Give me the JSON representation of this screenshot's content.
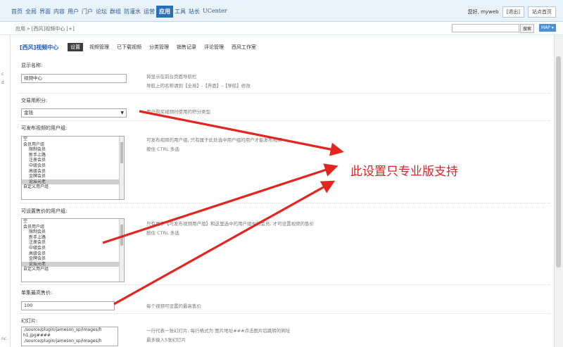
{
  "topnav": {
    "items": [
      "首页",
      "全局",
      "界面",
      "内容",
      "用户",
      "门户",
      "论坛",
      "群组",
      "防灌水",
      "运营",
      "应用",
      "工具",
      "站长",
      "UCenter"
    ],
    "active_index": 10,
    "greeting": "您好, myweb",
    "logout": "[退出]",
    "home_button": "站点首页"
  },
  "subbar": {
    "breadcrumb": "应用 » [西风]视频中心 [+]",
    "search_button": "搜索",
    "map_button": "MAP ▾"
  },
  "left_edge": {
    "labels": [
      "c",
      "d",
      "nc."
    ]
  },
  "plugin": {
    "title": "[西风]视频中心",
    "tabs": [
      "设置",
      "视频管理",
      "已下载视频",
      "分类管理",
      "销售记录",
      "评论管理",
      "西风工作室"
    ],
    "active_tab": 0
  },
  "form": {
    "display_name": {
      "label": "显示名称:",
      "value": "视频中心",
      "note1": "将显示在前台页面导航栏",
      "note2": "导航上的名称请到【全局】-【界面】-【导航】修改"
    },
    "trade_credit": {
      "label": "交易用积分:",
      "value": "金钱",
      "note": "用户购买视频时使用的积分类型"
    },
    "publish_groups": {
      "label": "可发布视频的用户组:",
      "items": [
        {
          "text": "空",
          "indent": false,
          "selected": false
        },
        {
          "text": "会员用户组",
          "indent": false,
          "selected": false
        },
        {
          "text": "限制会员",
          "indent": true,
          "selected": false
        },
        {
          "text": "新手上路",
          "indent": true,
          "selected": false
        },
        {
          "text": "注册会员",
          "indent": true,
          "selected": false
        },
        {
          "text": "中级会员",
          "indent": true,
          "selected": false
        },
        {
          "text": "高级会员",
          "indent": true,
          "selected": false
        },
        {
          "text": "金牌会员",
          "indent": true,
          "selected": false
        },
        {
          "text": "论坛元老",
          "indent": true,
          "selected": true
        },
        {
          "text": "自定义用户组",
          "indent": false,
          "selected": false
        }
      ],
      "note1": "可发布视频的用户组, 只有属于此处选中用户组的用户才能发布视频",
      "note2": "按住 CTRL 多选"
    },
    "price_groups": {
      "label": "可设置售价的用户组:",
      "items": [
        {
          "text": "空",
          "indent": false,
          "selected": false
        },
        {
          "text": "会员用户组",
          "indent": false,
          "selected": false
        },
        {
          "text": "限制会员",
          "indent": true,
          "selected": false
        },
        {
          "text": "新手上路",
          "indent": true,
          "selected": false
        },
        {
          "text": "注册会员",
          "indent": true,
          "selected": false
        },
        {
          "text": "中级会员",
          "indent": true,
          "selected": false
        },
        {
          "text": "高级会员",
          "indent": true,
          "selected": false
        },
        {
          "text": "金牌会员",
          "indent": true,
          "selected": false
        },
        {
          "text": "论坛元老",
          "indent": true,
          "selected": true
        },
        {
          "text": "自定义用户组",
          "indent": false,
          "selected": false
        }
      ],
      "note1": "只有属于【可发布视频用户组】和这里选中的用户组中的会员, 才可设置视频的售价",
      "note2": "按住 CTRL 多选"
    },
    "max_price": {
      "label": "单集最高售价:",
      "value": "100",
      "note": "每个视频可设置的最高售价"
    },
    "slides": {
      "label": "幻灯片:",
      "value_lines": [
        "./source/plugin/jameson_sp/images/h",
        "h1.jpg####",
        "./source/plugin/jameson_sp/images/h"
      ],
      "note1": "一行代表一张幻灯片, 每行格式为 图片地址###点击图片后跳转的网址",
      "note2": "最多输入5张幻灯片"
    }
  },
  "annotation": {
    "text": "此设置只专业版支持",
    "color": "#d0262a"
  }
}
